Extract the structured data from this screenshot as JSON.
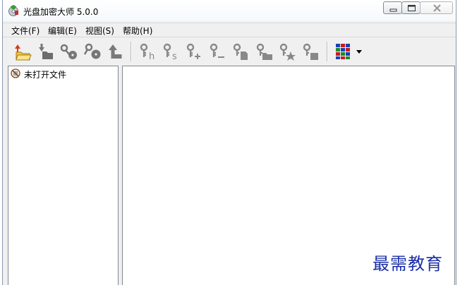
{
  "window": {
    "title": "光盘加密大师 5.0.0",
    "app_icon": "disc-key-icon",
    "controls": [
      "minimize-icon",
      "maximize-icon",
      "close-icon"
    ]
  },
  "menu": {
    "items": [
      {
        "label": "文件(F)"
      },
      {
        "label": "编辑(E)"
      },
      {
        "label": "视图(S)"
      },
      {
        "label": "帮助(H)"
      }
    ]
  },
  "toolbar": {
    "icons": [
      "open-folder-icon",
      "load-icon",
      "encrypt-disc-icon",
      "decrypt-disc-icon",
      "upload-icon",
      "key-h-icon",
      "key-s-icon",
      "key-add-icon",
      "key-remove-icon",
      "key-file-icon",
      "key-folder-icon",
      "key-star-icon",
      "key-drive-icon",
      "view-grid-icon",
      "dropdown-arrow-icon"
    ]
  },
  "left_pane": {
    "items": [
      {
        "label": "未打开文件",
        "icon": "no-file-icon"
      }
    ]
  },
  "watermark": {
    "text": "最需教育",
    "color": "#1b2ea6"
  }
}
